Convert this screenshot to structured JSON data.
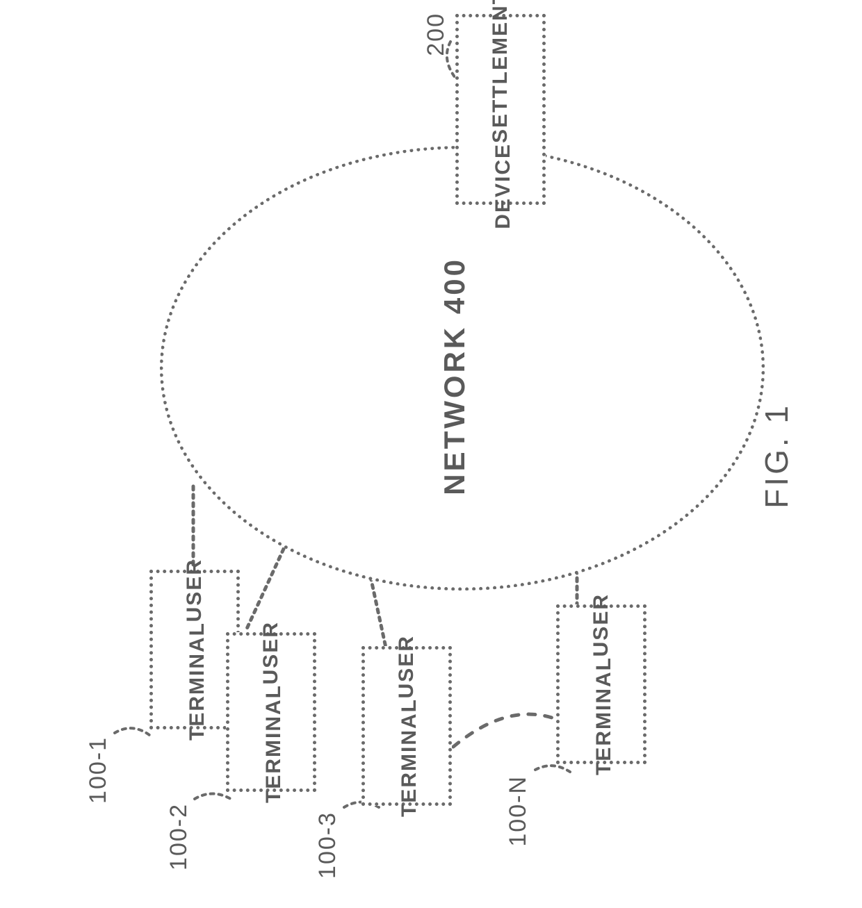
{
  "figure_caption": "FIG. 1",
  "settlement": {
    "line1": "SETTLEMENT",
    "line2": "DEVICE",
    "ref": "200"
  },
  "network": {
    "label": "NETWORK 400"
  },
  "terminals": {
    "t1": {
      "line1": "USER",
      "line2": "TERMINAL",
      "ref": "100-1"
    },
    "t2": {
      "line1": "USER",
      "line2": "TERMINAL",
      "ref": "100-2"
    },
    "t3": {
      "line1": "USER",
      "line2": "TERMINAL",
      "ref": "100-3"
    },
    "tn": {
      "line1": "USER",
      "line2": "TERMINAL",
      "ref": "100-N"
    }
  }
}
